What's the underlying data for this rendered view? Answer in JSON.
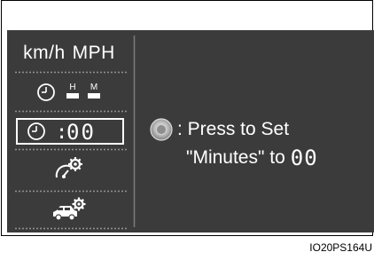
{
  "menu": {
    "unit_kmh": "km/h",
    "unit_mph": "MPH",
    "hour_marker": "H",
    "minute_marker": "M",
    "clock_colon": ":",
    "clock_digits": "00"
  },
  "instruction": {
    "line1": ": Press to Set",
    "line2_prefix": "\"Minutes\" to",
    "digits": "00"
  },
  "caption": "IO20PS164U",
  "colors": {
    "screen_bg": "#3b3b3b",
    "text": "#ffffff",
    "knob_outer": "#c8c8c8"
  },
  "icons": {
    "clock": "clock-icon",
    "gauge_gear": "gauge-settings-icon",
    "car_gear": "vehicle-settings-icon",
    "knob": "selector-knob-icon"
  }
}
